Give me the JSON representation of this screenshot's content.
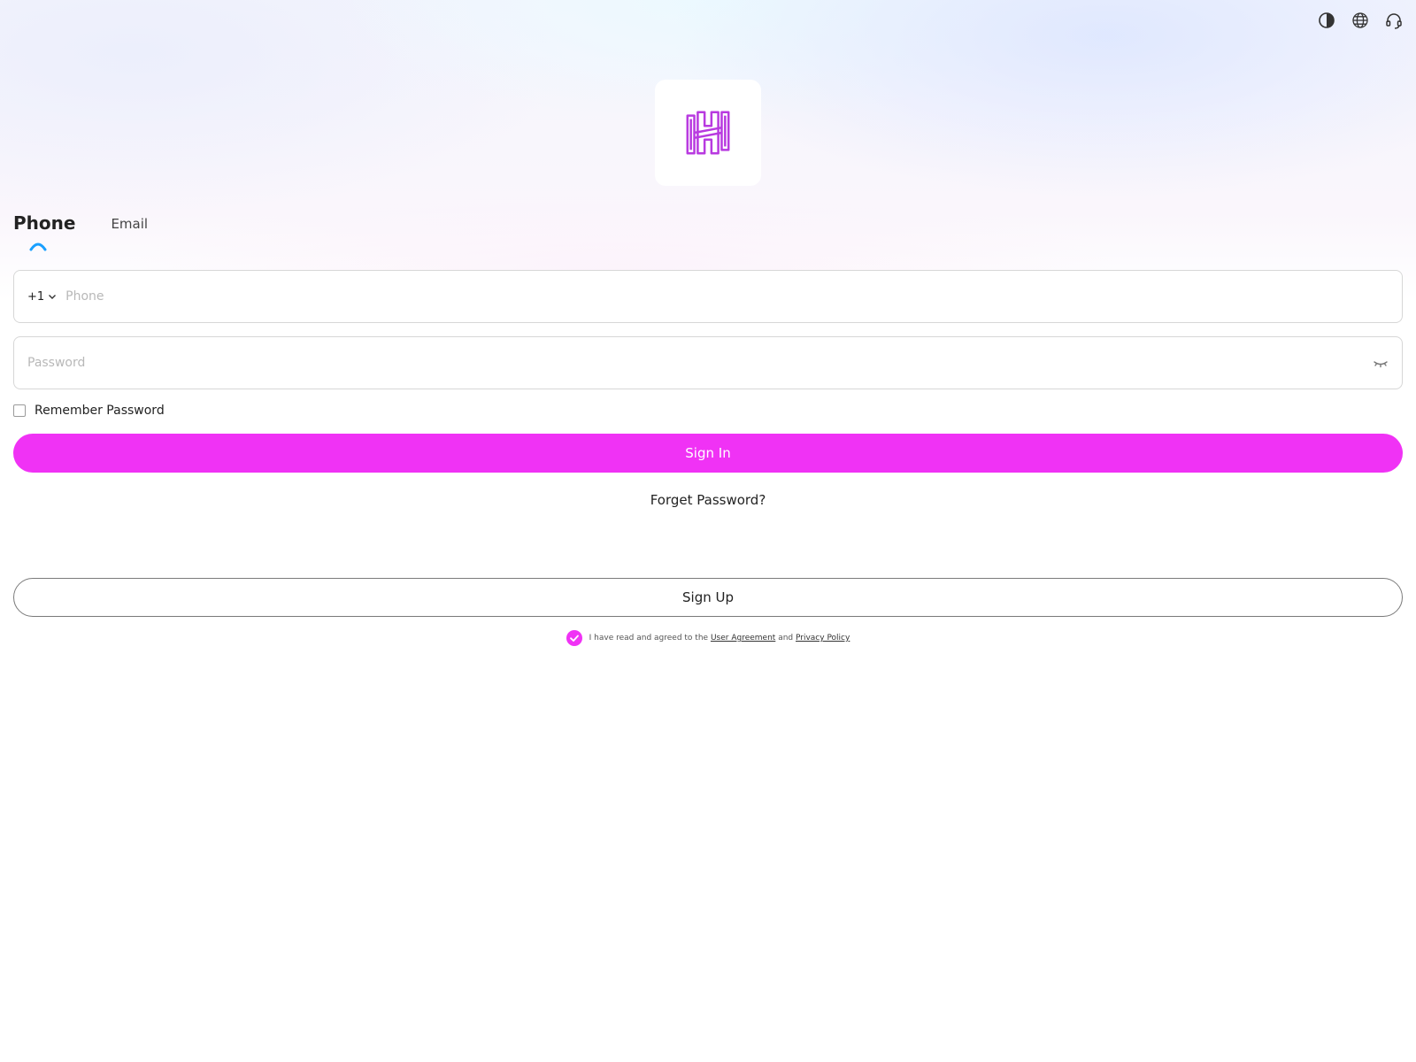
{
  "tabs": {
    "phone": "Phone",
    "email": "Email"
  },
  "phone_field": {
    "country_code": "+1",
    "placeholder": "Phone",
    "value": ""
  },
  "password_field": {
    "placeholder": "Password",
    "value": ""
  },
  "remember": {
    "label": "Remember Password",
    "checked": false
  },
  "buttons": {
    "sign_in": "Sign In",
    "forget": "Forget Password?",
    "sign_up": "Sign Up"
  },
  "agreement": {
    "prefix": "I have read and agreed to the",
    "user_agreement": "User Agreement",
    "and": "and",
    "privacy_policy": "Privacy Policy",
    "checked": true
  },
  "icons": {
    "theme": "contrast-icon",
    "language": "globe-icon",
    "support": "headset-icon",
    "logo": "brand-logo-icon",
    "password_toggle": "eye-closed-icon"
  },
  "colors": {
    "accent": "#f032f5",
    "logo": "#b83ae0",
    "tab_indicator": "#1aa0ff"
  }
}
